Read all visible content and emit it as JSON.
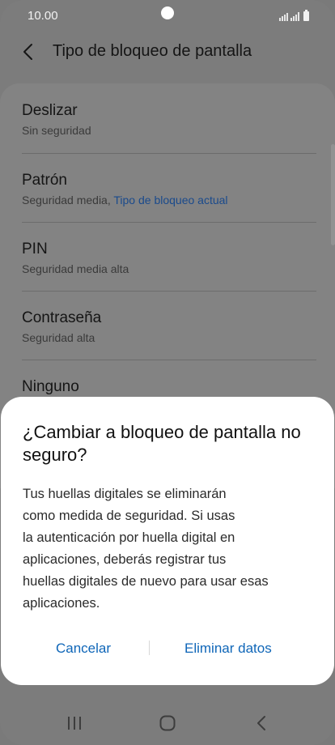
{
  "status_bar": {
    "time": "10.00"
  },
  "header": {
    "title": "Tipo de bloqueo de pantalla",
    "back_icon": "chevron-left-icon"
  },
  "lock_options": [
    {
      "title": "Deslizar",
      "subtitle": "Sin seguridad",
      "current_label": ""
    },
    {
      "title": "Patrón",
      "subtitle": "Seguridad media, ",
      "current_label": "Tipo de bloqueo actual"
    },
    {
      "title": "PIN",
      "subtitle": "Seguridad media alta",
      "current_label": ""
    },
    {
      "title": "Contraseña",
      "subtitle": "Seguridad alta",
      "current_label": ""
    },
    {
      "title": "Ninguno",
      "subtitle": "",
      "current_label": ""
    }
  ],
  "dialog": {
    "title": "¿Cambiar a bloqueo de pantalla no seguro?",
    "body_lines": [
      "Tus huellas digitales se eliminarán",
      "como medida de seguridad. Si usas",
      "la autenticación por huella digital en",
      "aplicaciones, deberás registrar tus",
      "huellas digitales de nuevo para usar esas",
      "aplicaciones."
    ],
    "cancel_label": "Cancelar",
    "confirm_label": "Eliminar datos"
  },
  "colors": {
    "accent": "#0f66b8",
    "current_lock_text": "#1a4a8c",
    "dim_background": "#7c7c7c"
  },
  "nav_bar": {
    "recents_icon": "recents-icon",
    "home_icon": "home-icon",
    "back_icon": "back-icon"
  }
}
